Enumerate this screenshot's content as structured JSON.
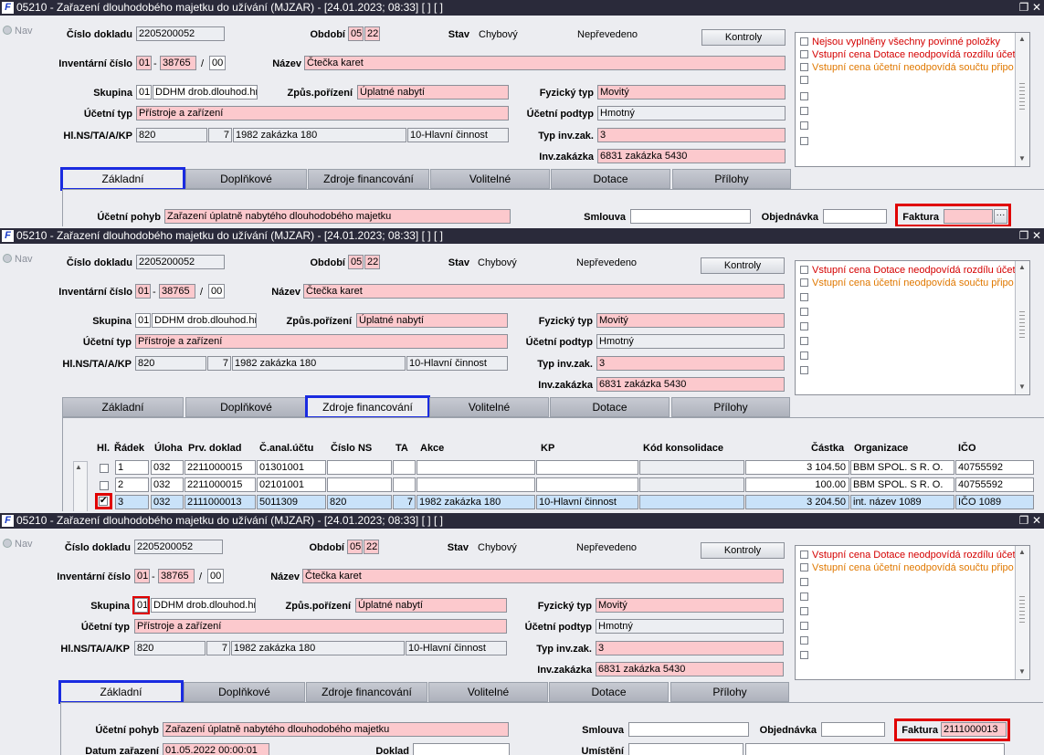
{
  "window": {
    "title": "05210 - Zařazení dlouhodobého majetku do užívání (MJZAR) - [24.01.2023; 08:33]  [ ]  [ ]",
    "logo": "F",
    "restore_icon": "restore-window-icon",
    "close_icon": "close-icon"
  },
  "nav_label": "Nav",
  "labels": {
    "cislo_dokladu": "Číslo dokladu",
    "obdobi": "Období",
    "stav": "Stav",
    "inv_cislo": "Inventární číslo",
    "nazev": "Název",
    "skupina": "Skupina",
    "zpusob": "Způs.pořízení",
    "fyzicky_typ": "Fyzický typ",
    "ucetni_typ": "Účetní typ",
    "ucetni_podtyp": "Účetní podtyp",
    "hlns": "Hl.NS/TA/A/KP",
    "typ_inv_zak": "Typ inv.zak.",
    "inv_zakazka": "Inv.zakázka",
    "ucetni_pohyb": "Účetní pohyb",
    "smlouva": "Smlouva",
    "objednavka": "Objednávka",
    "faktura": "Faktura",
    "datum_zarazeni": "Datum zařazení",
    "doklad": "Doklad",
    "umisteni": "Umístění",
    "sep_dash": "-",
    "sep_slash": "/"
  },
  "values": {
    "cislo_dokladu": "2205200052",
    "obdobi_1": "05",
    "obdobi_2": "22",
    "stav_1": "Chybový",
    "stav_2": "Nepřevedeno",
    "inv_1": "01",
    "inv_2": "38765",
    "inv_3": "00",
    "nazev": "Čtečka karet",
    "skupina_code": "01",
    "skupina_name": "DDHM drob.dlouhod.hm",
    "zpusob": "Úplatné nabytí",
    "fyzicky_typ": "Movitý",
    "ucetni_typ": "Přístroje a zařízení",
    "ucetni_podtyp": "Hmotný",
    "hlns_1": "820",
    "hlns_2": "7",
    "hlns_3": "1982 zakázka 180",
    "hlns_4": "10-Hlavní činnost",
    "typ_inv_zak": "3",
    "inv_zakazka": "6831 zakázka 5430",
    "ucetni_pohyb": "Zařazení úplatně nabytého dlouhodobého majetku",
    "faktura_empty": "",
    "faktura_filled": "2111000013",
    "datum_zarazeni": "01.05.2022 00:00:01",
    "lov_button": "···"
  },
  "buttons": {
    "kontroly": "Kontroly"
  },
  "messages_panel1": [
    {
      "text": "Nejsou vyplněny všechny povinné položky",
      "color": "#d40000"
    },
    {
      "text": "Vstupní cena Dotace neodpovídá rozdílu účet",
      "color": "#d40000"
    },
    {
      "text": "Vstupní cena účetní neodpovídá součtu připo",
      "color": "#e07800"
    }
  ],
  "messages_panel23": [
    {
      "text": "Vstupní cena Dotace neodpovídá rozdílu účet",
      "color": "#d40000"
    },
    {
      "text": "Vstupní cena účetní neodpovídá součtu připo",
      "color": "#e07800"
    }
  ],
  "tabs": [
    "Základní",
    "Doplňkové",
    "Zdroje financování",
    "Volitelné",
    "Dotace",
    "Přílohy"
  ],
  "table": {
    "headers": [
      "Hl.",
      "Řádek",
      "Úloha",
      "Prv. doklad",
      "Č.anal.účtu",
      "Číslo NS",
      "TA",
      "Akce",
      "KP",
      "Kód konsolidace",
      "Částka",
      "Organizace",
      "IČO"
    ],
    "rows": [
      {
        "hl": "",
        "radek": "1",
        "uloha": "032",
        "prv": "2211000015",
        "anal": "01301001",
        "ns": "",
        "ta": "",
        "akce": "",
        "kp": "",
        "kod": "",
        "castka": "3 104.50",
        "org": "BBM SPOL. S R. O.",
        "ico": "40755592"
      },
      {
        "hl": "",
        "radek": "2",
        "uloha": "032",
        "prv": "2211000015",
        "anal": "02101001",
        "ns": "",
        "ta": "",
        "akce": "",
        "kp": "",
        "kod": "",
        "castka": "100.00",
        "org": "BBM SPOL. S R. O.",
        "ico": "40755592"
      },
      {
        "hl": "✔",
        "radek": "3",
        "uloha": "032",
        "prv": "2111000013",
        "anal": "5011309",
        "ns": "820",
        "ta": "7",
        "akce": "1982 zakázka 180",
        "kp": "10-Hlavní činnost",
        "kod": "",
        "castka": "3 204.50",
        "org": "int. název 1089",
        "ico": "IČO 1089"
      }
    ]
  },
  "colors": {
    "required_field": "#fcc9cd",
    "readonly_field": "#eceef2",
    "selected_row": "#c9e2f9",
    "highlight_blue": "#1a2be0",
    "highlight_red": "#e00000",
    "titlebar": "#2a2a3a"
  }
}
